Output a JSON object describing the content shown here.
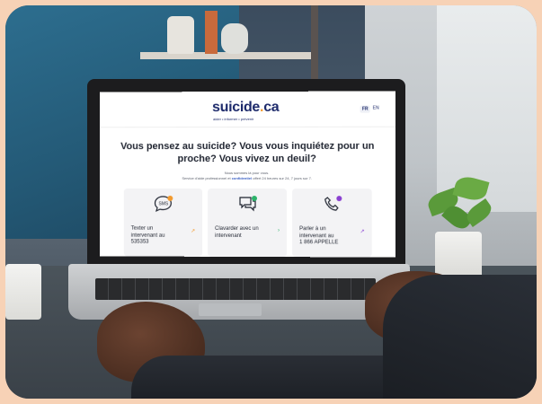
{
  "site": {
    "logo_main": "suicide",
    "logo_dot": ".",
    "logo_tld": "ca",
    "tagline": "aider • informer • prévenir",
    "lang_fr": "FR",
    "lang_en": "EN"
  },
  "hero": {
    "headline_line1": "Vous pensez au suicide? Vous vous inquiétez pour un",
    "headline_line2": "proche? Vous vivez un deuil?",
    "sub_line1": "Nous sommes là pour vous.",
    "sub_line2_a": "Service d'aide professionnel et",
    "sub_line2_hl": "confidentiel",
    "sub_line2_b": "offert 24 heures sur 24, 7 jours sur 7."
  },
  "cards": [
    {
      "label_line1": "Texter un",
      "label_line2": "intervenant au",
      "label_line3": "535353",
      "icon": "sms-icon",
      "badge_color": "#f29a2e",
      "arrow": "↗",
      "arrow_color": "#f29a2e"
    },
    {
      "label_line1": "Clavarder avec un",
      "label_line2": "intervenant",
      "label_line3": "",
      "icon": "chat-icon",
      "badge_color": "#2db36b",
      "arrow": "›",
      "arrow_color": "#2db36b"
    },
    {
      "label_line1": "Parler à un",
      "label_line2": "intervenant au",
      "label_line3": "1 866 APPELLE",
      "icon": "phone-icon",
      "badge_color": "#8a3fd1",
      "arrow": "↗",
      "arrow_color": "#8a3fd1"
    }
  ]
}
